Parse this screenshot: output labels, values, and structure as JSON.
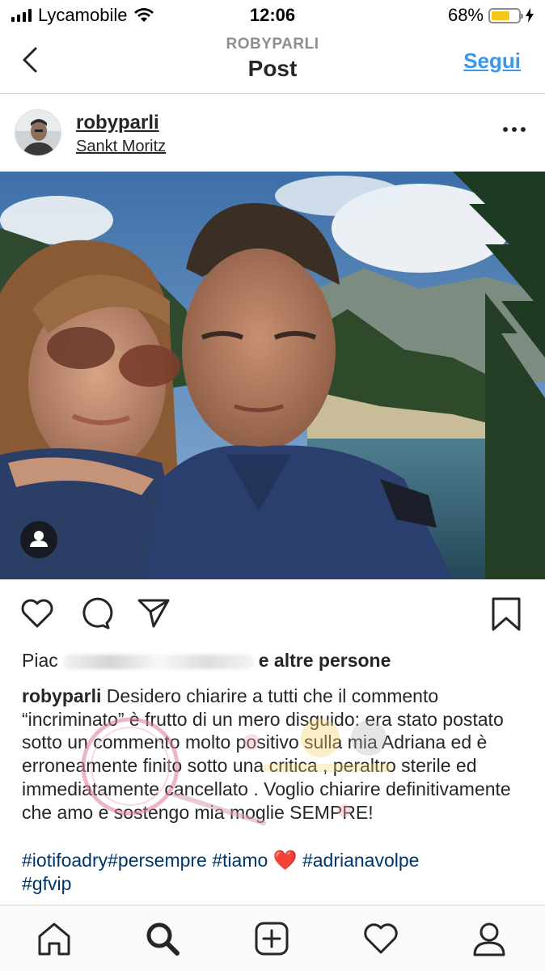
{
  "status_bar": {
    "carrier": "Lycamobile",
    "time": "12:06",
    "battery_percent": "68%",
    "battery_level": 0.68,
    "battery_color": "#f5c518"
  },
  "nav": {
    "subtitle": "ROBYPARLI",
    "title": "Post",
    "follow_label": "Segui",
    "back_icon": "chevron-left-icon"
  },
  "post": {
    "username": "robyparli",
    "location": "Sankt Moritz",
    "more_icon": "more-horizontal-icon"
  },
  "actions": {
    "icons": [
      "heart-icon",
      "comment-icon",
      "share-icon",
      "bookmark-icon"
    ]
  },
  "likes": {
    "prefix": "Piac",
    "suffix": "e altre persone"
  },
  "caption": {
    "username": "robyparli",
    "text": " Desidero chiarire a tutti che il commento “incriminato” è frutto di un mero disguido: era stato postato sotto un commento molto positivo sulla mia Adriana ed è erroneamente finito sotto una critica , peraltro sterile ed immediatamente cancellato . Voglio chiarire definitivamente che amo e sostengo mia moglie SEMPRE!"
  },
  "hashtags": {
    "line1": "#iotifoadry#persempre #tiamo",
    "emoji": "❤️",
    "line1_end": " #adrianavolpe",
    "line2": "#gfvip"
  },
  "tabbar": {
    "icons": [
      "home-icon",
      "search-icon",
      "new-post-icon",
      "activity-heart-icon",
      "profile-icon"
    ]
  },
  "colors": {
    "link_blue": "#3897f0",
    "hashtag_blue": "#003569",
    "text": "#262626",
    "muted": "#8e8e8e"
  }
}
